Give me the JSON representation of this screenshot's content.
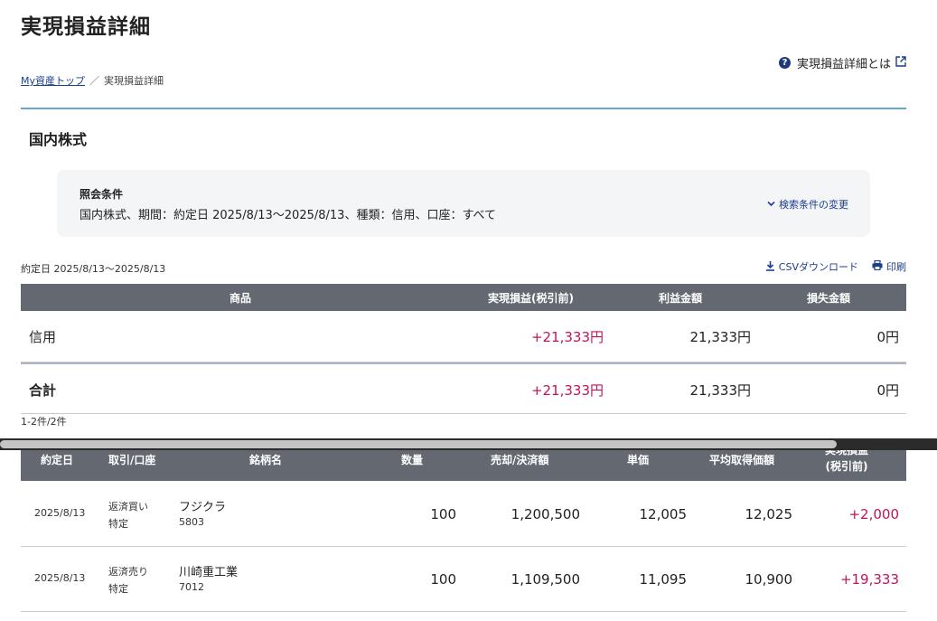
{
  "page": {
    "title": "実現損益詳細",
    "help_link": "実現損益詳細とは"
  },
  "breadcrumb": {
    "home": "My資産トップ",
    "sep": "／",
    "current": "実現損益詳細"
  },
  "section": {
    "title": "国内株式"
  },
  "conditions": {
    "label": "照会条件",
    "text": "国内株式、期間：約定日 2025/8/13〜2025/8/13、種類：信用、口座：すべて",
    "change_label": "検索条件の変更"
  },
  "period_text": "約定日 2025/8/13〜2025/8/13",
  "actions": {
    "csv": "CSVダウンロード",
    "print": "印刷"
  },
  "summary": {
    "headers": [
      "商品",
      "実現損益(税引前)",
      "利益金額",
      "損失金額"
    ],
    "rows": [
      {
        "product": "信用",
        "realized": "+21,333円",
        "profit": "21,333円",
        "loss": "0円"
      }
    ],
    "total": {
      "product": "合計",
      "realized": "+21,333円",
      "profit": "21,333円",
      "loss": "0円"
    }
  },
  "count_text": "1-2件/2件",
  "detail": {
    "headers": {
      "date": "約定日",
      "trade": "取引/口座",
      "name": "銘柄名",
      "qty": "数量",
      "amount": "売却/決済額",
      "price": "単価",
      "avg": "平均取得価額",
      "pl_line1": "実現損益",
      "pl_line2": "(税引前)"
    },
    "rows": [
      {
        "date": "2025/8/13",
        "trade": "返済買い",
        "account": "特定",
        "name": "フジクラ",
        "code": "5803",
        "qty": "100",
        "amount": "1,200,500",
        "price": "12,005",
        "avg": "12,025",
        "pl": "+2,000"
      },
      {
        "date": "2025/8/13",
        "trade": "返済売り",
        "account": "特定",
        "name": "川崎重工業",
        "code": "7012",
        "qty": "100",
        "amount": "1,109,500",
        "price": "11,095",
        "avg": "10,900",
        "pl": "+19,333"
      }
    ]
  },
  "colors": {
    "header_bg": "#636871",
    "positive": "#c0145a",
    "link": "#1a3d8f",
    "rule": "#5fa8cf"
  }
}
